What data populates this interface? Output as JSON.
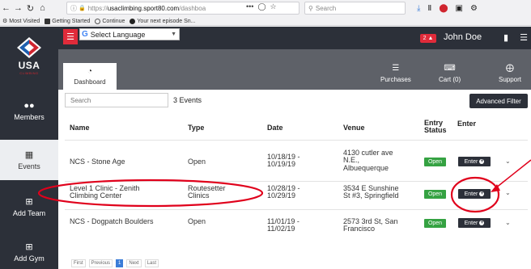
{
  "browser": {
    "url_prefix": "https://",
    "url_host": "usaclimbing.sport80.com",
    "url_path": "/dashboa",
    "more_dots": "•••",
    "search_placeholder": "Search",
    "bookmarks": [
      "Most Visited",
      "Getting Started",
      "Continue",
      "Your next episode  Sn..."
    ]
  },
  "header": {
    "language_label": "Select Language",
    "language_arrow": "▼",
    "notification_count": "2",
    "username": "John Doe"
  },
  "sidebar": {
    "logo_text": "USA",
    "logo_sub": "CLIMBING",
    "items": [
      {
        "label": "Members",
        "icon": "users-icon"
      },
      {
        "label": "Events",
        "icon": "calendar-icon"
      },
      {
        "label": "Add Team",
        "icon": "plus-square-icon"
      },
      {
        "label": "Add Gym",
        "icon": "plus-square-icon"
      }
    ]
  },
  "subnav": {
    "dashboard": "Dashboard",
    "purchases": "Purchases",
    "cart": "Cart (0)",
    "support": "Support"
  },
  "content": {
    "search_placeholder": "Search",
    "event_count": "3 Events",
    "advanced_filter": "Advanced Filter",
    "columns": {
      "name": "Name",
      "type": "Type",
      "date": "Date",
      "venue": "Venue",
      "entry_status_1": "Entry",
      "entry_status_2": "Status",
      "enter": "Enter"
    },
    "events": [
      {
        "name1": "NCS - Stone Age",
        "name2": "",
        "type1": "Open",
        "type2": "",
        "date1": "10/18/19 -",
        "date2": "10/19/19",
        "venue1": "4130 cutler ave",
        "venue2": "N.E.,",
        "venue3": "Albuequerque",
        "status": "Open",
        "enter": "Enter"
      },
      {
        "name1": "Level 1 Clinic - Zenith",
        "name2": "Climbing Center",
        "type1": "Routesetter",
        "type2": "Clinics",
        "date1": "10/28/19 -",
        "date2": "10/29/19",
        "venue1": "3534 E Sunshine",
        "venue2": "St #3, Springfield",
        "venue3": "",
        "status": "Open",
        "enter": "Enter"
      },
      {
        "name1": "NCS - Dogpatch Boulders",
        "name2": "",
        "type1": "Open",
        "type2": "",
        "date1": "11/01/19 -",
        "date2": "11/02/19",
        "venue1": "2573 3rd St, San",
        "venue2": "Francisco",
        "venue3": "",
        "status": "Open",
        "enter": "Enter"
      }
    ],
    "pagination": [
      "First",
      "Previous",
      "1",
      "Next",
      "Last"
    ]
  },
  "colors": {
    "brand_red": "#e02b3a",
    "dark_nav": "#2c3039",
    "open_green": "#35a242",
    "annotation_red": "#e0001b"
  }
}
